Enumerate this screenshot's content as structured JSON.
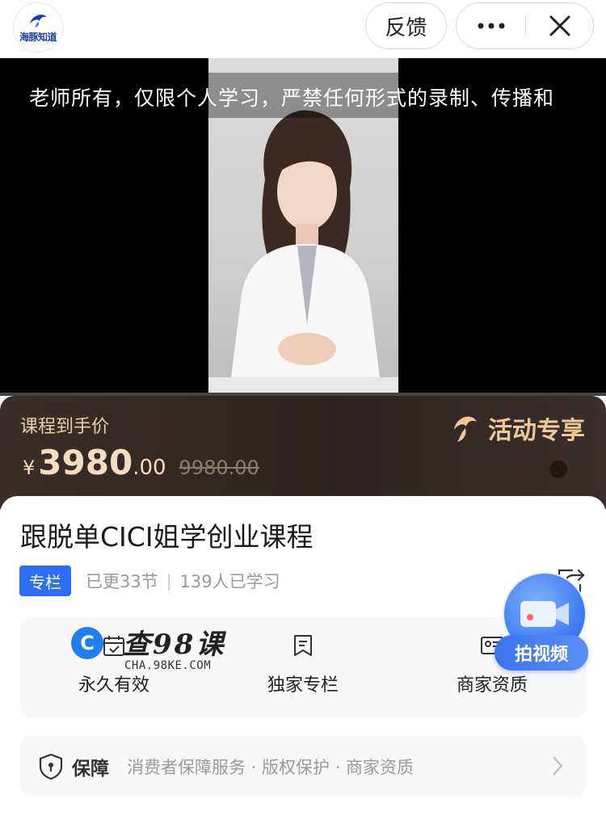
{
  "topbar": {
    "logo_text": "海豚知道",
    "feedback_label": "反馈"
  },
  "video": {
    "watermark": "老师所有，仅限个人学习，严禁任何形式的录制、传播和"
  },
  "price": {
    "label": "课程到手价",
    "currency": "¥",
    "integer": "3980",
    "decimal": ".00",
    "original": "9980.00",
    "promo_label": "活动专享"
  },
  "course": {
    "title": "跟脱单CICI姐学创业课程",
    "tag": "专栏",
    "updated": "已更33节",
    "separator": "|",
    "learners": "139人已学习"
  },
  "features": [
    {
      "label": "永久有效",
      "icon": "calendar-check-icon"
    },
    {
      "label": "独家专栏",
      "icon": "bookmark-icon"
    },
    {
      "label": "商家资质",
      "icon": "id-card-icon"
    }
  ],
  "guarantee": {
    "title": "保障",
    "text": "消费者保障服务 · 版权保护 · 商家资质"
  },
  "site_watermark": {
    "logo_letter": "C",
    "title": "查98课",
    "subtitle": "CHA.98KE.COM"
  },
  "shoot_video": {
    "label": "拍视频"
  },
  "colors": {
    "accent_blue": "#2d6ef5",
    "price_gold": "#f6dcc0",
    "banner_dark": "#2c2320"
  }
}
